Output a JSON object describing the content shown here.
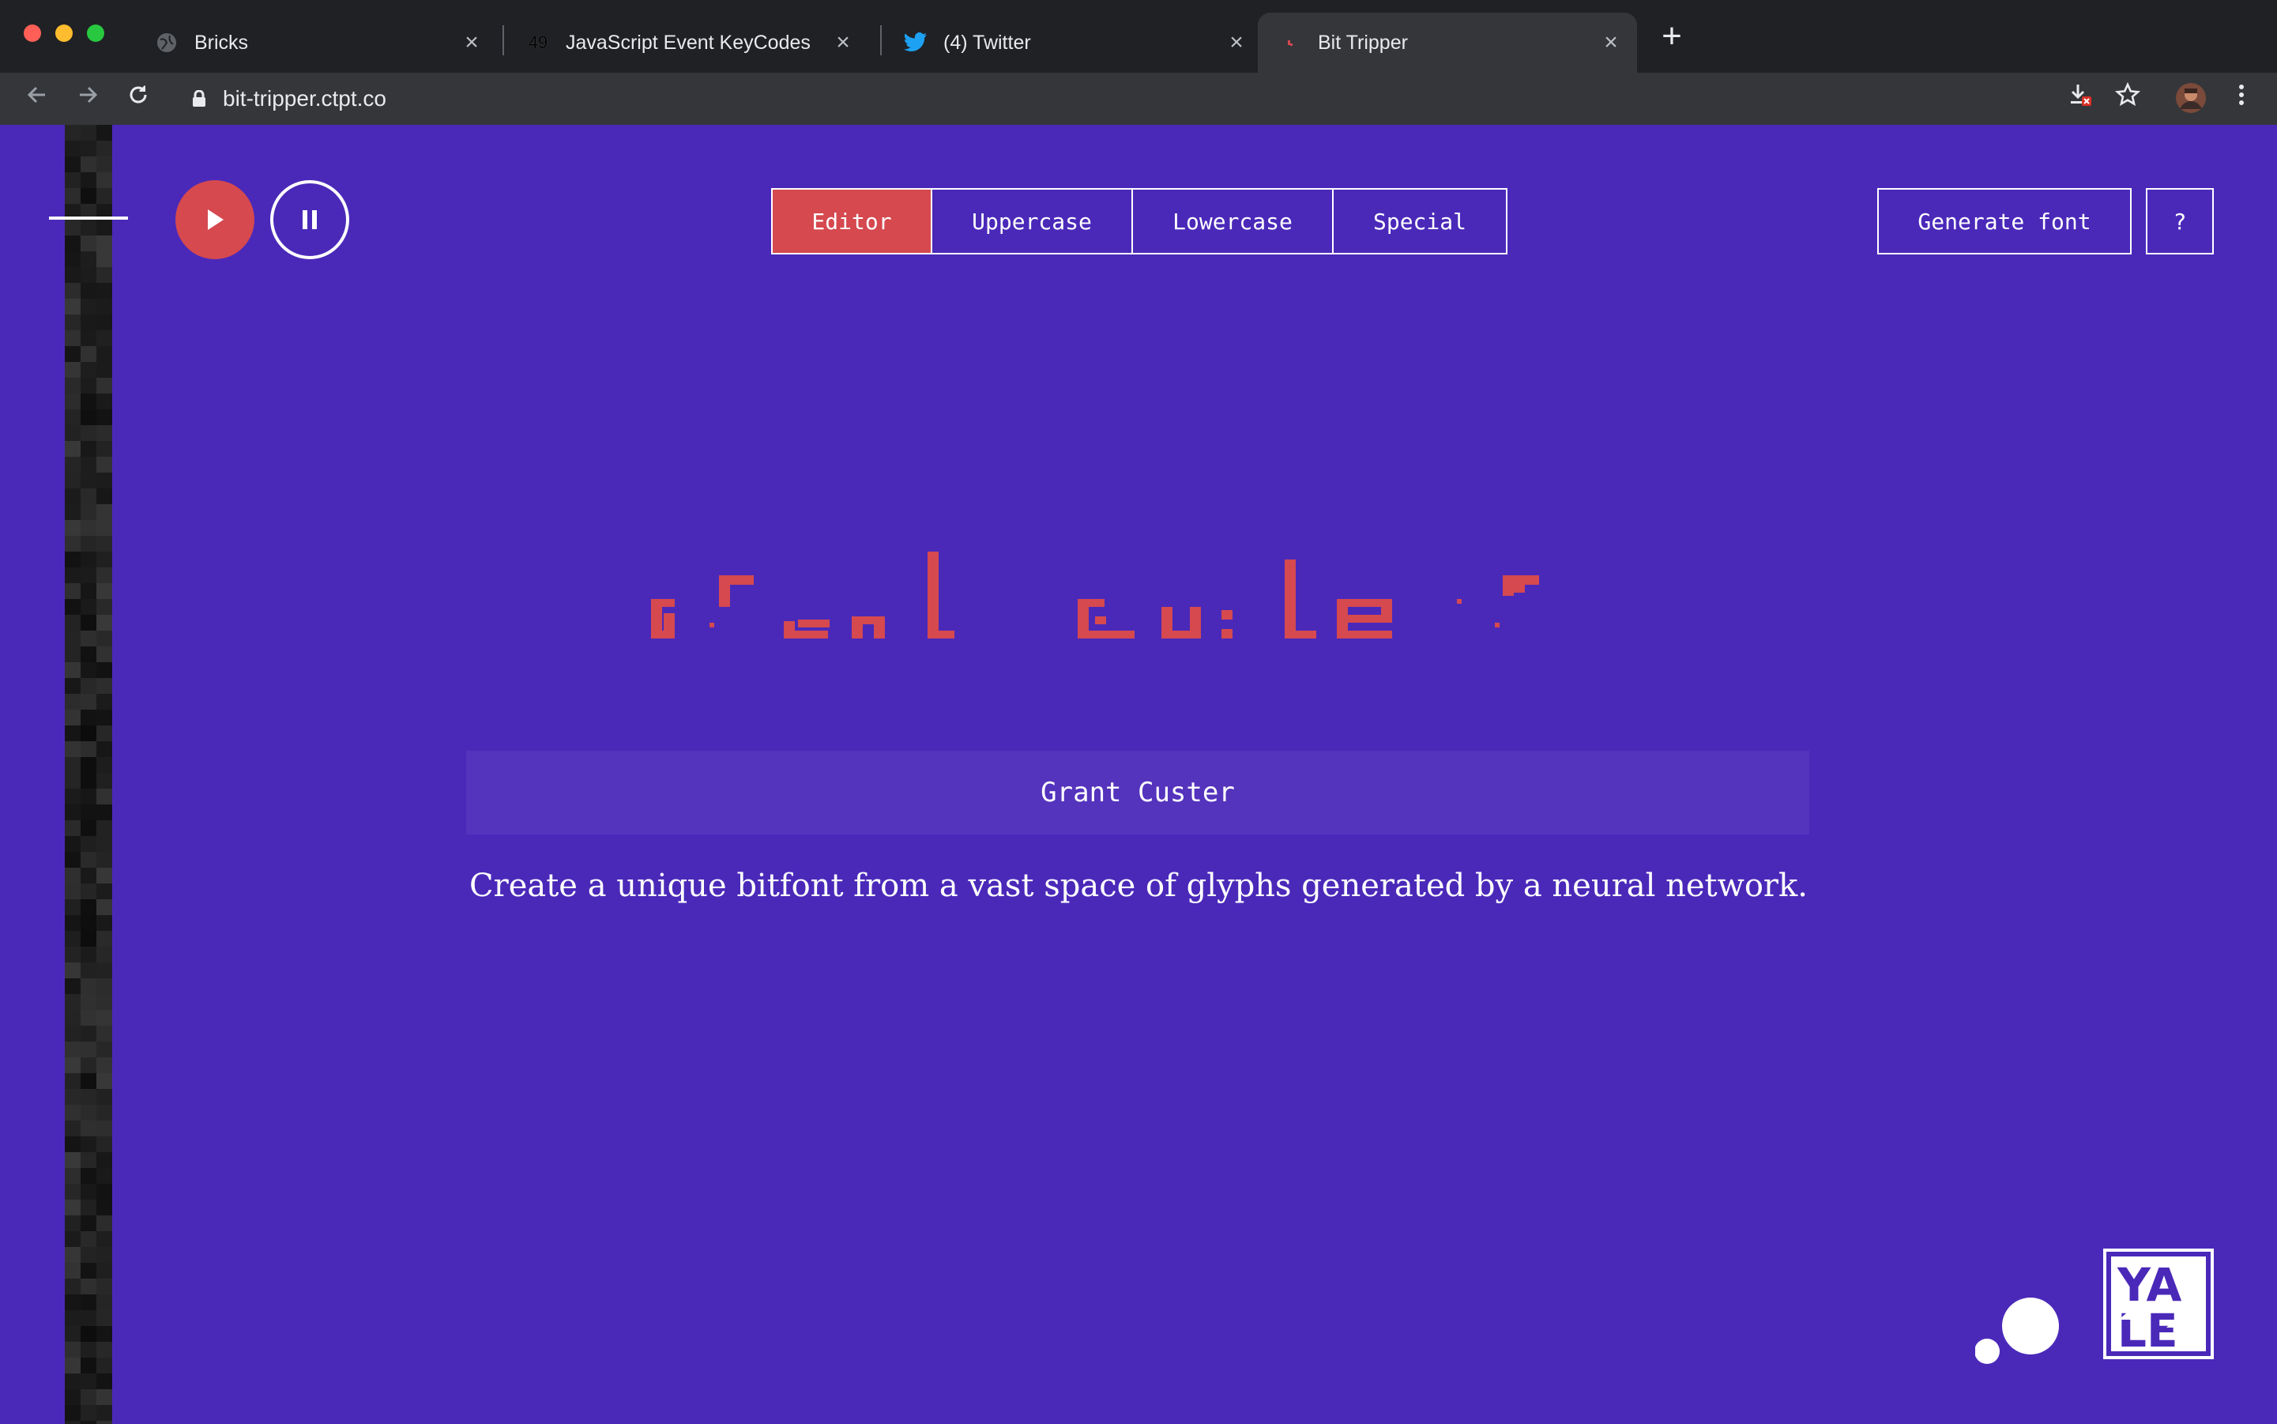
{
  "browser": {
    "tabs": [
      {
        "label": "Bricks",
        "icon": "globe-icon",
        "active": false
      },
      {
        "label": "JavaScript Event KeyCodes",
        "icon": "keycode-icon",
        "favicon_text": "49",
        "active": false
      },
      {
        "label": "(4) Twitter",
        "icon": "twitter-icon",
        "active": false
      },
      {
        "label": "Bit Tripper",
        "icon": "bit-tripper-icon",
        "active": true
      }
    ],
    "close_glyph": "×",
    "newtab_glyph": "+",
    "url": "bit-tripper.ctpt.co"
  },
  "app": {
    "modes": [
      "Editor",
      "Uppercase",
      "Lowercase",
      "Special"
    ],
    "active_mode": "Editor",
    "generate_label": "Generate font",
    "help_label": "?",
    "name_value": "Grant Custer",
    "tagline": "Create a unique bitfont from a vast space of glyphs generated by a neural network.",
    "logo_text": "YALE"
  },
  "colors": {
    "page_bg": "#4a29b9",
    "accent": "#d5494f",
    "input_bg": "#5433bd"
  }
}
